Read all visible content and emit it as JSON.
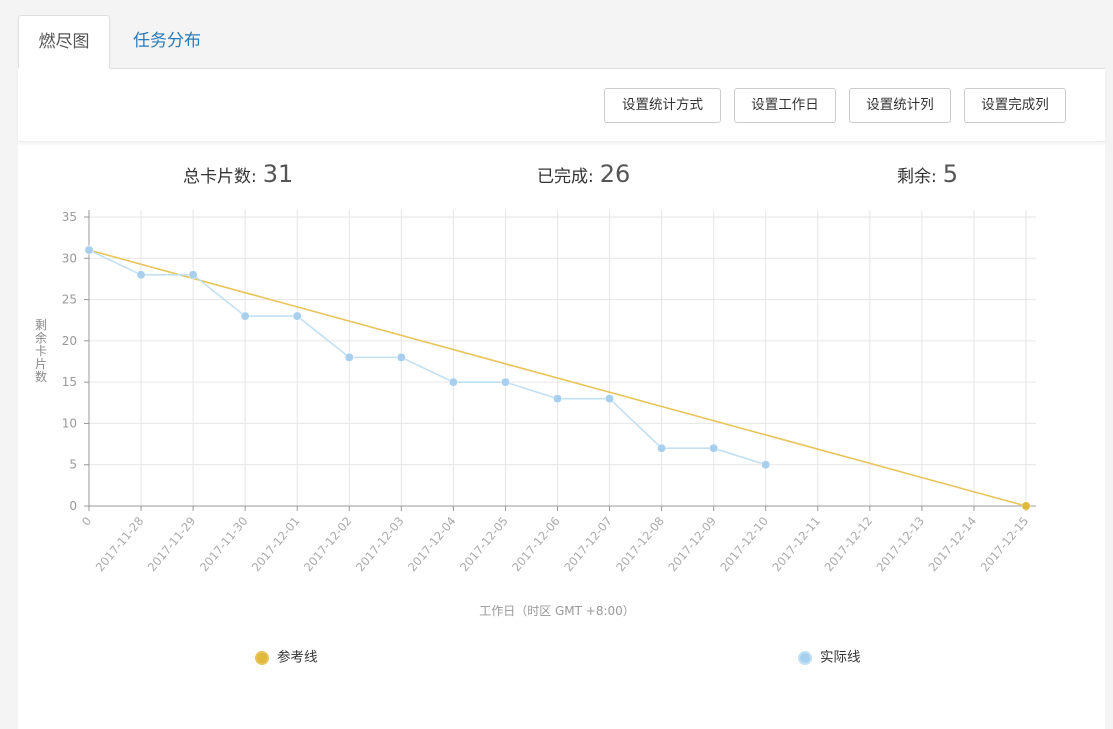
{
  "tabs": [
    {
      "label": "燃尽图"
    },
    {
      "label": "任务分布"
    }
  ],
  "toolbar": {
    "stat_method_label": "设置统计方式",
    "workday_label": "设置工作日",
    "stat_column_label": "设置统计列",
    "done_column_label": "设置完成列"
  },
  "summary": {
    "total_label": "总卡片数:",
    "total_value": "31",
    "done_label": "已完成:",
    "done_value": "26",
    "remaining_label": "剩余:",
    "remaining_value": "5"
  },
  "chart_data": {
    "type": "line",
    "xlabel": "工作日（时区 GMT +8:00）",
    "ylabel": "剩余卡片数",
    "ylim": [
      0,
      35
    ],
    "yticks": [
      0,
      5,
      10,
      15,
      20,
      25,
      30,
      35
    ],
    "categories": [
      "0",
      "2017-11-28",
      "2017-11-29",
      "2017-11-30",
      "2017-12-01",
      "2017-12-02",
      "2017-12-03",
      "2017-12-04",
      "2017-12-05",
      "2017-12-06",
      "2017-12-07",
      "2017-12-08",
      "2017-12-09",
      "2017-12-10",
      "2017-12-11",
      "2017-12-12",
      "2017-12-13",
      "2017-12-14",
      "2017-12-15"
    ],
    "grid": true,
    "legend_position": "bottom",
    "series": [
      {
        "name": "参考线",
        "color": "#e8c45a",
        "dot_color": "#e0b83a",
        "values": [
          31,
          null,
          null,
          null,
          null,
          null,
          null,
          null,
          null,
          null,
          null,
          null,
          null,
          null,
          null,
          null,
          null,
          null,
          0
        ]
      },
      {
        "name": "实际线",
        "color": "#c2e0f4",
        "dot_color": "#a8d0ee",
        "values": [
          31,
          28,
          28,
          23,
          23,
          18,
          18,
          15,
          15,
          13,
          13,
          7,
          7,
          5,
          null,
          null,
          null,
          null,
          null
        ]
      }
    ]
  }
}
